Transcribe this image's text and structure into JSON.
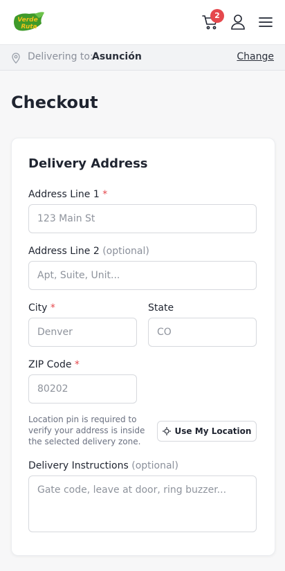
{
  "header": {
    "logo_text": "Verde Ruta",
    "cart_count": "2",
    "icons": [
      "cart-icon",
      "user-icon",
      "menu-icon"
    ]
  },
  "delivery_bar": {
    "label": "Delivering to:",
    "city": "Asunción",
    "change": "Change"
  },
  "page": {
    "title": "Checkout"
  },
  "form": {
    "title": "Delivery Address",
    "address1": {
      "label": "Address Line 1",
      "required": "*",
      "placeholder": "123 Main St"
    },
    "address2": {
      "label": "Address Line 2",
      "optional": "(optional)",
      "placeholder": "Apt, Suite, Unit..."
    },
    "city": {
      "label": "City",
      "required": "*",
      "placeholder": "Denver"
    },
    "state": {
      "label": "State",
      "placeholder": "CO"
    },
    "zip": {
      "label": "ZIP Code",
      "required": "*",
      "placeholder": "80202"
    },
    "location_hint": "Location pin is required to verify your address is inside the selected delivery zone.",
    "use_location": "Use My Location",
    "instructions": {
      "label": "Delivery Instructions",
      "optional": "(optional)",
      "placeholder": "Gate code, leave at door, ring buzzer..."
    }
  },
  "colors": {
    "accent_green": "#3f9a2a",
    "logo_yellow": "#f2c21a",
    "badge_red": "#e5484d",
    "required_red": "#e5484d"
  }
}
